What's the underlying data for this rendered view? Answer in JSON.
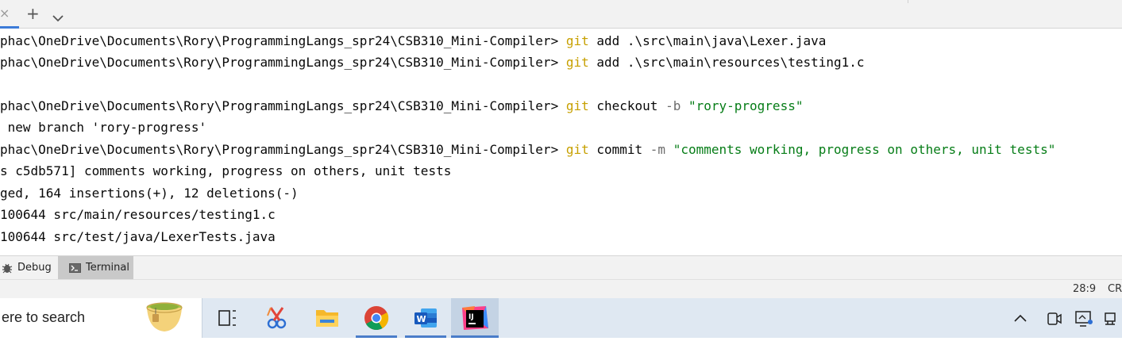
{
  "tabs": {
    "close_glyph": "×",
    "add_glyph": "+"
  },
  "terminal": {
    "lines": [
      {
        "prompt": "phac\\OneDrive\\Documents\\Rory\\ProgrammingLangs_spr24\\CSB310_Mini-Compiler> ",
        "git": "git",
        "rest": " add .\\src\\main\\java\\Lexer.java"
      },
      {
        "prompt": "phac\\OneDrive\\Documents\\Rory\\ProgrammingLangs_spr24\\CSB310_Mini-Compiler> ",
        "git": "git",
        "rest": " add .\\src\\main\\resources\\testing1.c"
      },
      {
        "prompt": "phac\\OneDrive\\Documents\\Rory\\ProgrammingLangs_spr24\\CSB310_Mini-Compiler> ",
        "git": "git",
        "cmd": " checkout ",
        "flag": "-b",
        "space": " ",
        "arg": "\"rory-progress\""
      },
      {
        "text": " new branch 'rory-progress'"
      },
      {
        "prompt": "phac\\OneDrive\\Documents\\Rory\\ProgrammingLangs_spr24\\CSB310_Mini-Compiler> ",
        "git": "git",
        "cmd": " commit ",
        "flag": "-m",
        "space": " ",
        "arg": "\"comments working, progress on others, unit tests\""
      },
      {
        "text": "s c5db571] comments working, progress on others, unit tests"
      },
      {
        "text": "ged, 164 insertions(+), 12 deletions(-)"
      },
      {
        "text": "100644 src/main/resources/testing1.c"
      },
      {
        "text": "100644 src/test/java/LexerTests.java"
      }
    ]
  },
  "toolwindows": {
    "debug_label": "Debug",
    "terminal_label": "Terminal"
  },
  "statusbar": {
    "position": "28:9",
    "line_sep": "CR"
  },
  "taskbar": {
    "search_placeholder": "ere to search",
    "icons": [
      "task-view-icon",
      "snipping-tool-icon",
      "file-explorer-icon",
      "chrome-icon",
      "word-icon",
      "intellij-icon"
    ],
    "tray": [
      "chevron-up-icon",
      "meet-now-icon",
      "display-icon",
      "network-icon"
    ]
  },
  "colors": {
    "git_keyword": "#c7a000",
    "string": "#067d17",
    "flag": "#6c6c6c",
    "accent": "#3d7bd8"
  }
}
